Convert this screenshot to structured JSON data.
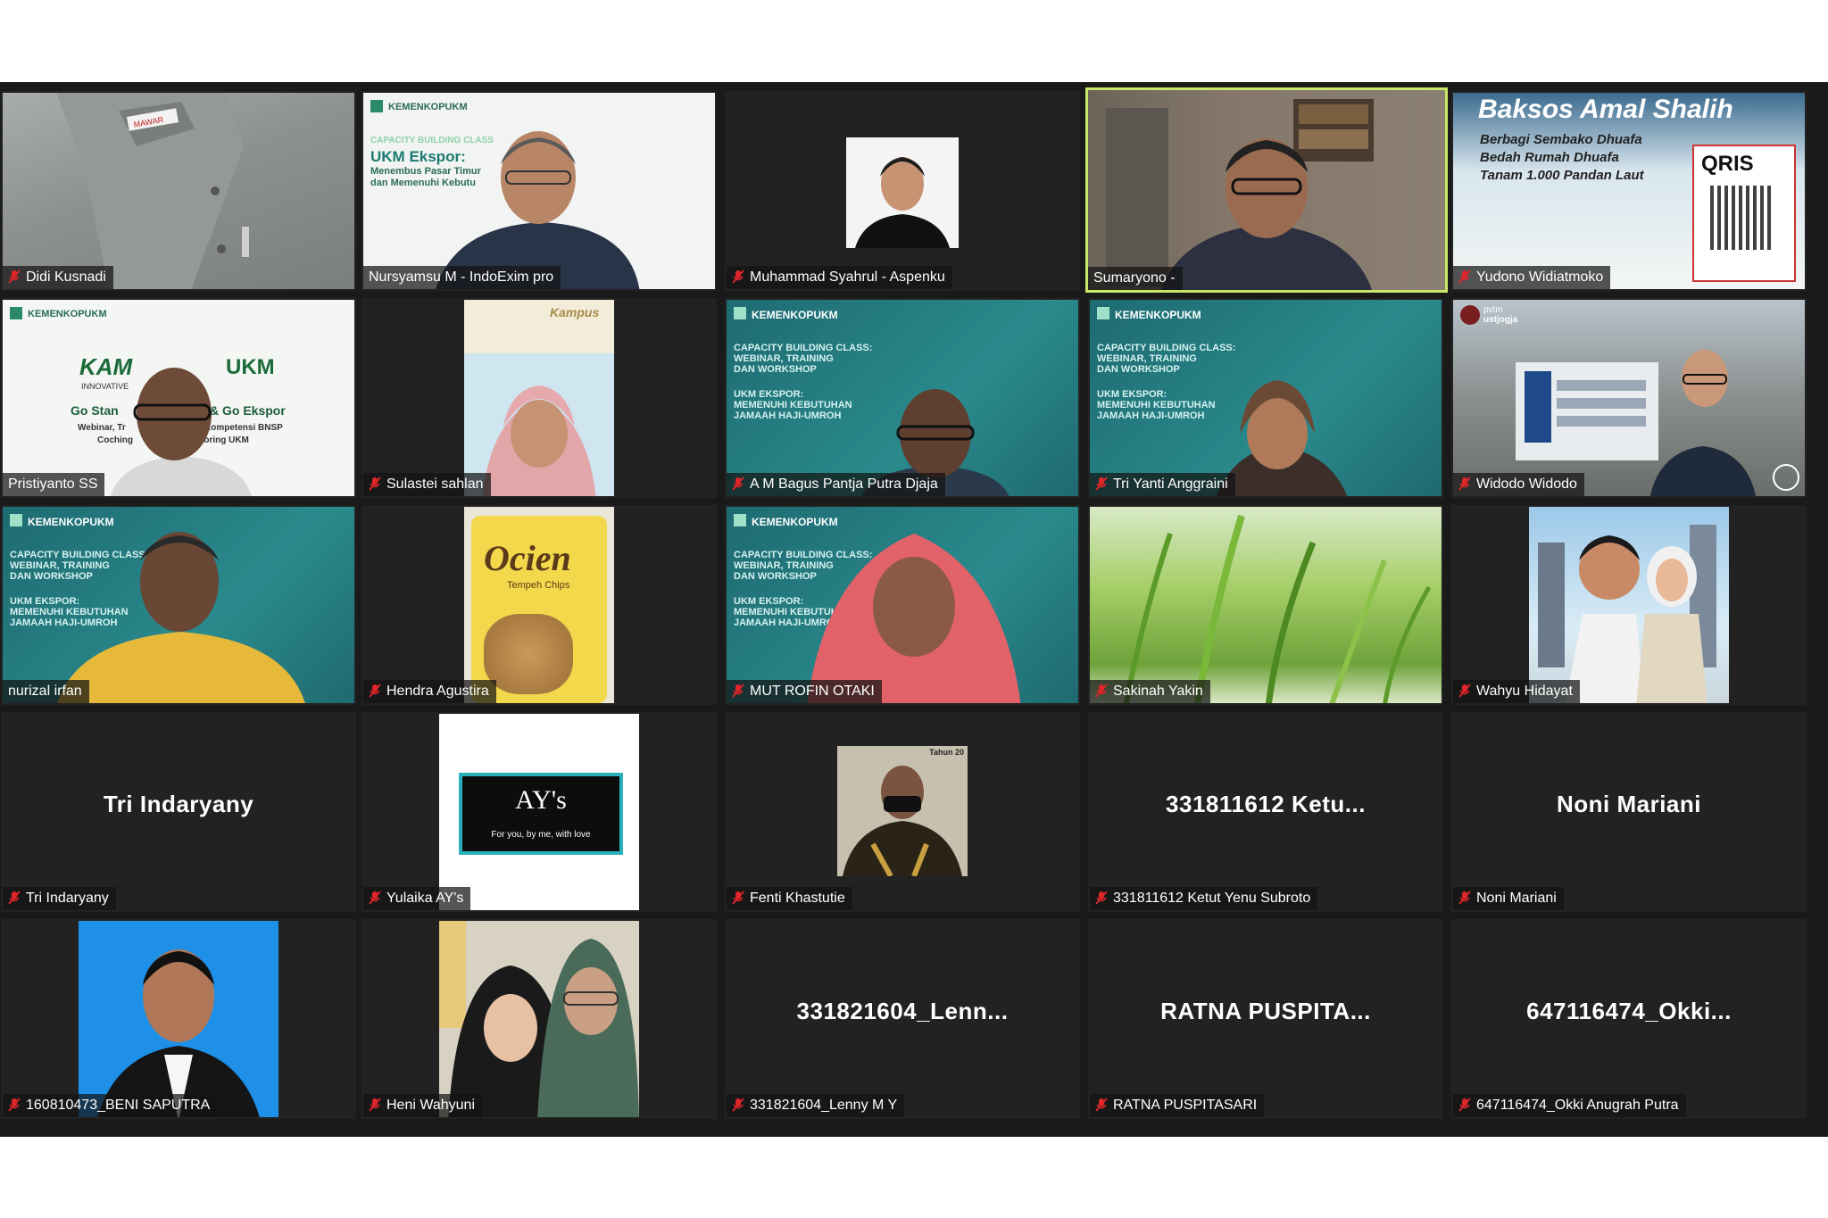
{
  "colors": {
    "background": "#1a1a1a",
    "tile": "#222222",
    "active_border": "#c9e86a",
    "muted_red": "#e0262a",
    "teal_slide": "#1f7a80"
  },
  "participants": [
    {
      "name": "Didi Kusnadi",
      "muted": true
    },
    {
      "name": "Nursyamsu M - IndoExim pro",
      "muted": false
    },
    {
      "name": "Muhammad Syahrul - Aspenku",
      "muted": true
    },
    {
      "name": "Sumaryono -",
      "muted": false,
      "active_speaker": true
    },
    {
      "name": "Yudono Widiatmoko",
      "muted": true
    },
    {
      "name": "Pristiyanto SS",
      "muted": false
    },
    {
      "name": "Sulastei sahlan",
      "muted": true
    },
    {
      "name": "A M Bagus Pantja Putra Djaja",
      "muted": true
    },
    {
      "name": "Tri Yanti Anggraini",
      "muted": true
    },
    {
      "name": "Widodo Widodo",
      "muted": true
    },
    {
      "name": "nurizal irfan",
      "muted": false
    },
    {
      "name": "Hendra Agustira",
      "muted": true
    },
    {
      "name": "MUT ROFIN OTAKI",
      "muted": true
    },
    {
      "name": "Sakinah Yakin",
      "muted": true
    },
    {
      "name": "Wahyu Hidayat",
      "muted": true
    },
    {
      "name": "Tri Indaryany",
      "muted": true,
      "display": "Tri Indaryany"
    },
    {
      "name": "Yulaika AY's",
      "muted": true
    },
    {
      "name": "Fenti Khastutie",
      "muted": true
    },
    {
      "name": "331811612 Ketut Yenu Subroto",
      "muted": true,
      "display": "331811612 Ketu..."
    },
    {
      "name": "Noni Mariani",
      "muted": true,
      "display": "Noni Mariani"
    },
    {
      "name": "160810473_BENI SAPUTRA",
      "muted": true
    },
    {
      "name": "Heni Wahyuni",
      "muted": true
    },
    {
      "name": "331821604_Lenny M Y",
      "muted": true,
      "display": "331821604_Lenn..."
    },
    {
      "name": "RATNA PUSPITASARI",
      "muted": true,
      "display": "RATNA  PUSPITA..."
    },
    {
      "name": "647116474_Okki Anugrah Putra",
      "muted": true,
      "display": "647116474_Okki..."
    }
  ],
  "content": {
    "kemenkop_logo": "KEMENKOPUKM",
    "capacity_class": "CAPACITY BUILDING CLASS",
    "ukm_ekspor": "UKM Ekspor:",
    "ukm_ekspor_sub1": "Menembus Pasar Timur",
    "ukm_ekspor_sub2": "dan Memenuhi Kebutu",
    "slide_l1": "CAPACITY BUILDING CLASS:",
    "slide_l2": "WEBINAR, TRAINING",
    "slide_l3": "DAN WORKSHOP",
    "slide_l4": "UKM EKSPOR:",
    "slide_l5": "MEMENUHI KEBUTUHAN",
    "slide_l6": "JAMAAH HAJI-UMROH",
    "baksos_title": "Baksos Amal Shalih",
    "baksos_1": "Berbagi Sembako Dhuafa",
    "baksos_2": "Bedah Rumah Dhuafa",
    "baksos_3": "Tanam 1.000 Pandan Laut",
    "qris": "QRIS",
    "kampus_ukm": "UKM",
    "kampus_prefix": "KAM",
    "innovative": "INNOVATIVE",
    "go_stan": "Go Stan",
    "go_ekspor": "& Go Ekspor",
    "webinar": "Webinar, Tr",
    "kompetensi": "Kompetensi BNSP",
    "coching": "Coching",
    "toring": "toring  UKM",
    "kampus_word": "Kampus",
    "ocien": "Ocien",
    "tempeh": "Tempeh Chips",
    "ays_title": "AY's",
    "ays_sub": "For you, by me, with love",
    "tahun": "Tahun 20",
    "pvtm": "pvtm",
    "ustjogja": "ustjogja",
    "mawar": "MAWAR"
  }
}
